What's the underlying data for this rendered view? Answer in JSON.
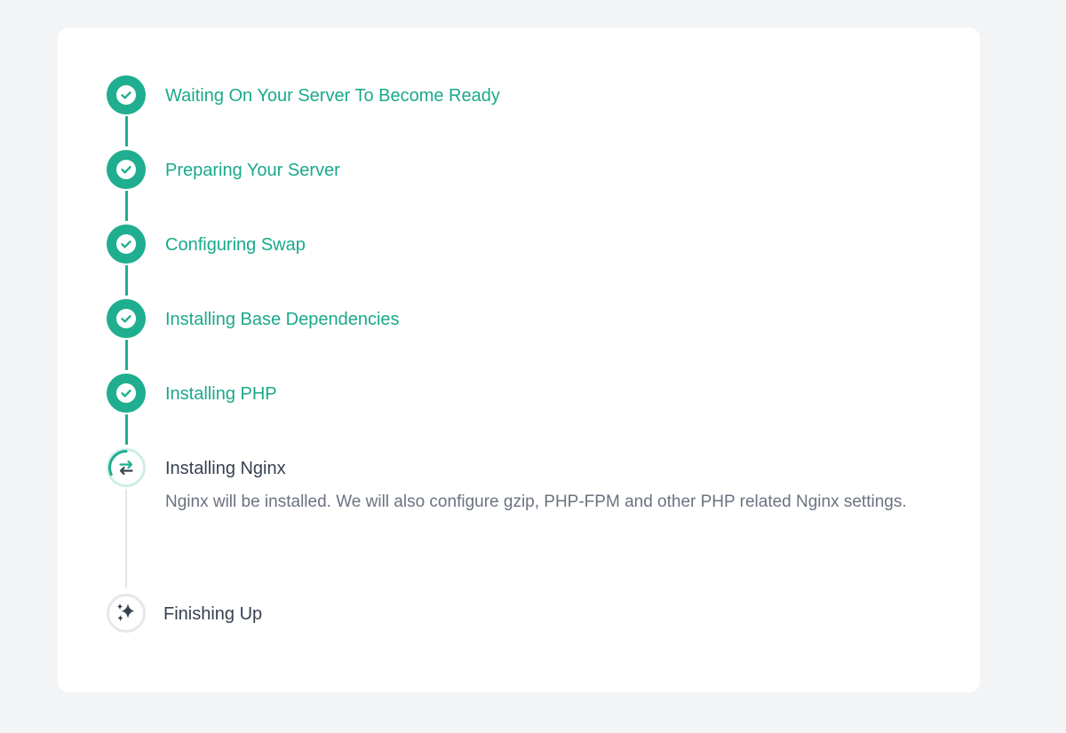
{
  "steps": [
    {
      "title": "Waiting On Your Server To Become Ready",
      "status": "completed",
      "icon": "check-icon"
    },
    {
      "title": "Preparing Your Server",
      "status": "completed",
      "icon": "check-icon"
    },
    {
      "title": "Configuring Swap",
      "status": "completed",
      "icon": "check-icon"
    },
    {
      "title": "Installing Base Dependencies",
      "status": "completed",
      "icon": "check-icon"
    },
    {
      "title": "Installing PHP",
      "status": "completed",
      "icon": "check-icon"
    },
    {
      "title": "Installing Nginx",
      "status": "in-progress",
      "icon": "swap-arrows-icon",
      "description": "Nginx will be installed. We will also configure gzip, PHP-FPM and other PHP related Nginx settings."
    },
    {
      "title": "Finishing Up",
      "status": "pending",
      "icon": "sparkles-icon"
    }
  ],
  "colors": {
    "accent": "#1fae8f",
    "accent_text": "#1aa98a",
    "active_ring": "#cdeee6",
    "pending_ring": "#e5e7eb",
    "dark_text": "#374151",
    "muted_text": "#6b7280",
    "page_bg": "#f3f4f6",
    "card_bg": "#ffffff"
  }
}
